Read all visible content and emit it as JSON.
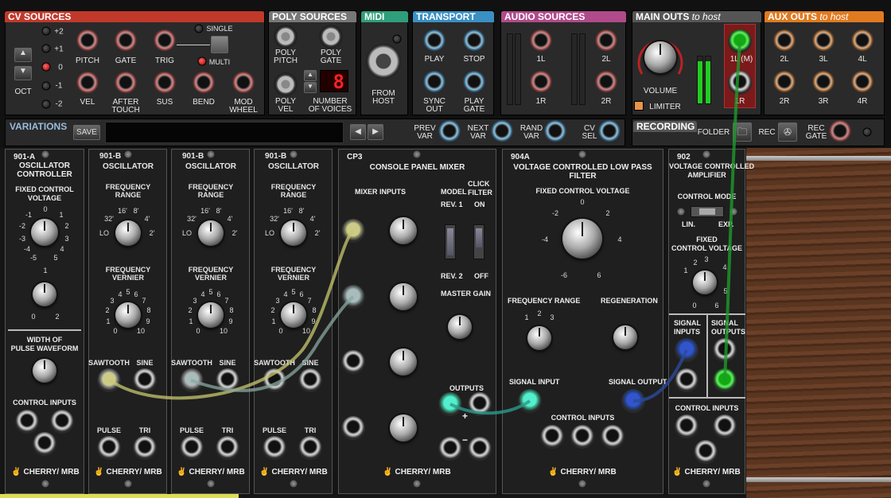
{
  "cv": {
    "header": "CV SOURCES",
    "oct_values": [
      "+2",
      "+1",
      "0",
      "-1",
      "-2"
    ],
    "oct_label": "OCT",
    "pitch": "PITCH",
    "gate": "GATE",
    "trig": "TRIG",
    "single": "SINGLE",
    "multi": "MULTI",
    "vel": "VEL",
    "after_touch": "AFTER\nTOUCH",
    "sus": "SUS",
    "bend": "BEND",
    "mod_wheel": "MOD\nWHEEL"
  },
  "poly": {
    "header": "POLY SOURCES",
    "pitch": "POLY\nPITCH",
    "gate": "POLY\nGATE",
    "vel": "POLY\nVEL",
    "num_voices_label": "NUMBER\nOF VOICES",
    "num_voices": "8"
  },
  "midi": {
    "header": "MIDI",
    "from_host": "FROM\nHOST"
  },
  "transport": {
    "header": "TRANSPORT",
    "play": "PLAY",
    "stop": "STOP",
    "sync_out": "SYNC\nOUT",
    "play_gate": "PLAY\nGATE"
  },
  "audio": {
    "header": "AUDIO SOURCES",
    "l1": "1L",
    "l2": "2L",
    "r1": "1R",
    "r2": "2R"
  },
  "main": {
    "header": "MAIN OUTS",
    "to_host": "to host",
    "volume": "VOLUME",
    "limiter": "LIMITER",
    "l1m": "1L (M)",
    "r1": "1R"
  },
  "aux": {
    "header": "AUX OUTS",
    "to_host": "to host",
    "labels_top": [
      "2L",
      "3L",
      "4L"
    ],
    "labels_bot": [
      "2R",
      "3R",
      "4R"
    ]
  },
  "variations": {
    "header": "VARIATIONS",
    "save": "SAVE",
    "prev": "PREV\nVAR",
    "next": "NEXT\nVAR",
    "rand": "RAND\nVAR",
    "cvsel": "CV\nSEL"
  },
  "recording": {
    "header": "RECORDING",
    "folder": "FOLDER",
    "rec": "REC",
    "rec_gate": "REC\nGATE"
  },
  "m901a": {
    "id": "901-A",
    "title": "OSCILLATOR\nCONTROLLER",
    "fcv": "FIXED CONTROL\nVOLTAGE",
    "scale1": [
      "-1",
      "0",
      "1",
      "-2",
      "2",
      "-3",
      "3",
      "-4",
      "4",
      "-5",
      "5",
      "6"
    ],
    "scale2": [
      "1",
      "0",
      "2"
    ],
    "pulse": "WIDTH OF\nPULSE WAVEFORM",
    "ctrl": "CONTROL INPUTS"
  },
  "m901b": {
    "id": "901-B",
    "title": "OSCILLATOR",
    "freq_range": "FREQUENCY\nRANGE",
    "fr_scale": [
      "16'",
      "8'",
      "32'",
      "4'",
      "LO",
      "2'"
    ],
    "vernier": "FREQUENCY\nVERNIER",
    "v_scale": [
      "4",
      "5",
      "6",
      "3",
      "7",
      "2",
      "8",
      "1",
      "9",
      "0",
      "10"
    ],
    "saw": "SAWTOOTH",
    "sine": "SINE",
    "pulse": "PULSE",
    "tri": "TRI"
  },
  "cp3": {
    "id": "CP3",
    "title": "CONSOLE PANEL MIXER",
    "mixer_inputs": "MIXER INPUTS",
    "model": "MODEL",
    "rev1": "REV. 1",
    "rev2": "REV. 2",
    "click": "CLICK\nFILTER",
    "on": "ON",
    "off": "OFF",
    "master": "MASTER GAIN",
    "outputs": "OUTPUTS",
    "plus": "+",
    "minus": "−"
  },
  "m904a": {
    "id": "904A",
    "title": "VOLTAGE CONTROLLED LOW PASS FILTER",
    "fcv": "FIXED CONTROL VOLTAGE",
    "fcv_scale": [
      "0",
      "-2",
      "2",
      "-4",
      "4",
      "-6",
      "6"
    ],
    "freq_range": "FREQUENCY RANGE",
    "fr_scale": [
      "1",
      "2",
      "3"
    ],
    "regen": "REGENERATION",
    "sig_in": "SIGNAL INPUT",
    "sig_out": "SIGNAL OUTPUT",
    "ctrl": "CONTROL  INPUTS"
  },
  "m902": {
    "id": "902",
    "title": "VOLTAGE CONTROLLED\nAMPLIFIER",
    "mode": "CONTROL MODE",
    "lin": "LIN.",
    "exp": "EXP.",
    "fcv": "FIXED\nCONTROL VOLTAGE",
    "fcv_scale": [
      "2",
      "3",
      "1",
      "4",
      "0",
      "5",
      "6"
    ],
    "sig_in": "SIGNAL\nINPUTS",
    "sig_out": "SIGNAL\nOUTPUTS",
    "ctrl": "CONTROL INPUTS"
  },
  "brand": "CHERRY/ MRB",
  "colors": {
    "cv": "#c0392b",
    "poly": "#777777",
    "midi": "#2f9e7a",
    "transport": "#3a8fc4",
    "audio": "#b04a8a",
    "main": "#666666",
    "aux": "#e07a20",
    "cable_yellow": "#c8c870",
    "cable_teal": "#6aa8a0",
    "cable_green": "#1e9a2a",
    "cable_blue": "#2a4a9a"
  }
}
